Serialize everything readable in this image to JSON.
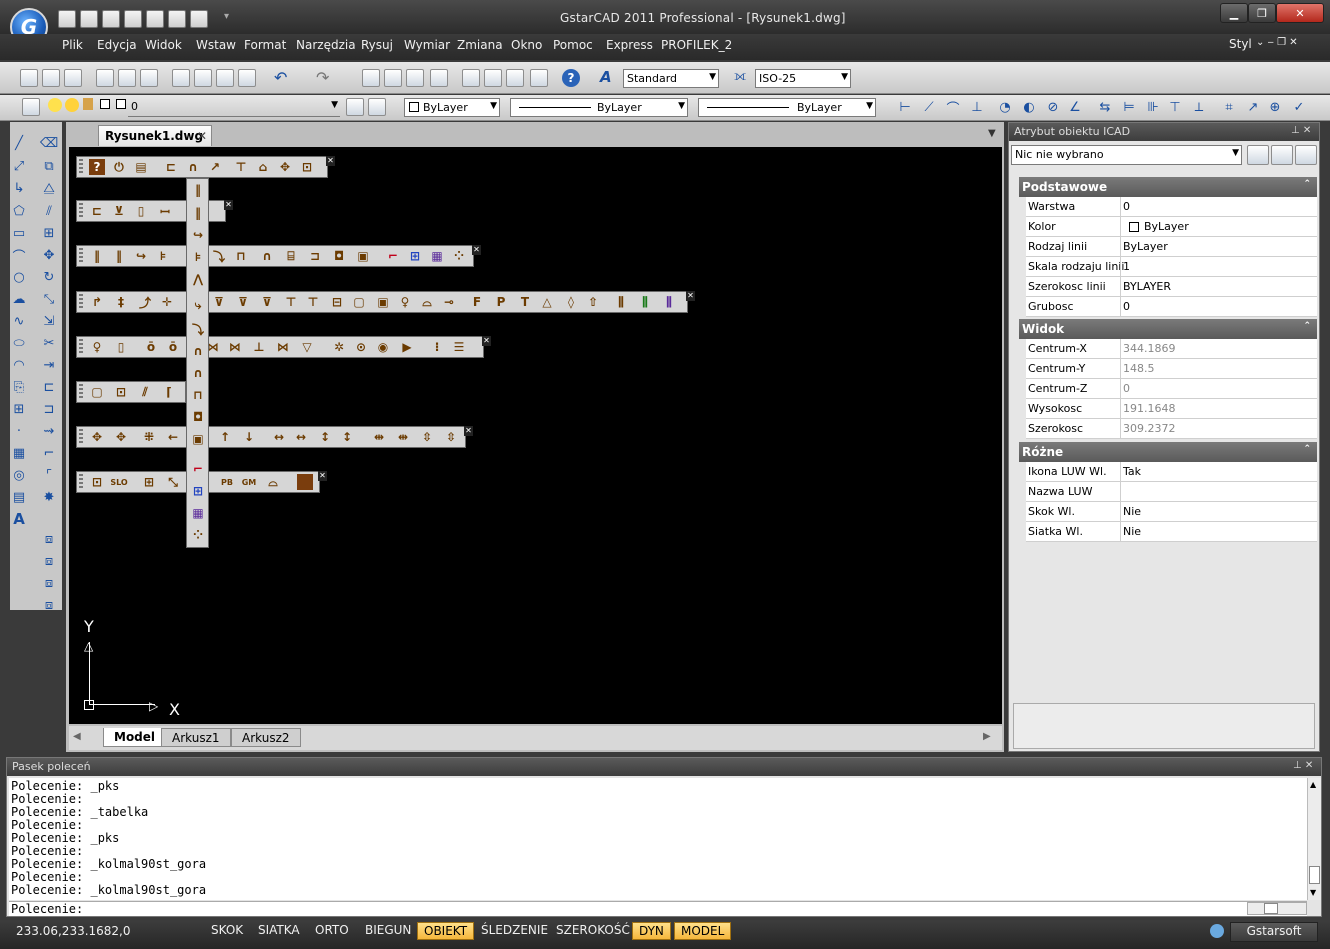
{
  "app": {
    "window_title": "GstarCAD 2011 Professional - [Rysunek1.dwg]",
    "logo_letter": "G",
    "style_label": "Styl"
  },
  "menu": [
    "Plik",
    "Edycja",
    "Widok",
    "Wstaw",
    "Format",
    "Narzędzia",
    "Rysuj",
    "Wymiar",
    "Zmiana",
    "Okno",
    "Pomoc",
    "Express",
    "PROFILEK_2"
  ],
  "toolbar": {
    "text_style": "Standard",
    "dim_style": "ISO-25",
    "layer": "0",
    "color": "ByLayer",
    "linetype": "ByLayer",
    "lineweight": "ByLayer"
  },
  "document": {
    "tab": "Rysunek1.dwg",
    "ucs_x": "X",
    "ucs_y": "Y",
    "sheets": [
      "Model",
      "Arkusz1",
      "Arkusz2"
    ]
  },
  "properties": {
    "title": "Atrybut obiektu ICAD",
    "selection": "Nic nie wybrano",
    "sections": [
      {
        "name": "Podstawowe",
        "rows": [
          {
            "k": "Warstwa",
            "v": "0"
          },
          {
            "k": "Kolor",
            "v": "ByLayer"
          },
          {
            "k": "Rodzaj linii",
            "v": "ByLayer"
          },
          {
            "k": "Skala rodzaju linii",
            "v": "1"
          },
          {
            "k": "Szerokosc linii",
            "v": "BYLAYER"
          },
          {
            "k": "Grubosc",
            "v": "0"
          }
        ]
      },
      {
        "name": "Widok",
        "rows": [
          {
            "k": "Centrum-X",
            "v": "344.1869"
          },
          {
            "k": "Centrum-Y",
            "v": "148.5"
          },
          {
            "k": "Centrum-Z",
            "v": "0"
          },
          {
            "k": "Wysokosc",
            "v": "191.1648"
          },
          {
            "k": "Szerokosc",
            "v": "309.2372"
          }
        ]
      },
      {
        "name": "Różne",
        "rows": [
          {
            "k": "Ikona LUW Wl.",
            "v": "Tak"
          },
          {
            "k": "Nazwa LUW",
            "v": ""
          },
          {
            "k": "Skok Wl.",
            "v": "Nie"
          },
          {
            "k": "Siatka Wl.",
            "v": "Nie"
          }
        ]
      }
    ]
  },
  "command": {
    "title": "Pasek poleceń",
    "log": [
      "Polecenie: _pks",
      "Polecenie:",
      "Polecenie: _tabelka",
      "Polecenie:",
      "Polecenie: _pks",
      "Polecenie:",
      "Polecenie: _kolmal90st_gora",
      "Polecenie:",
      "Polecenie: _kolmal90st_gora"
    ],
    "prompt": "Polecenie:"
  },
  "status": {
    "coords": "233.06,233.1682,0",
    "toggles": [
      {
        "label": "SKOK",
        "on": false
      },
      {
        "label": "SIATKA",
        "on": false
      },
      {
        "label": "ORTO",
        "on": false
      },
      {
        "label": "BIEGUN",
        "on": false
      },
      {
        "label": "OBIEKT",
        "on": true
      },
      {
        "label": "ŚLEDZENIE",
        "on": false
      },
      {
        "label": "SZEROKOŚĆ",
        "on": false
      },
      {
        "label": "DYN",
        "on": true
      },
      {
        "label": "MODEL",
        "on": true
      }
    ],
    "brand": "Gstarsoft"
  }
}
